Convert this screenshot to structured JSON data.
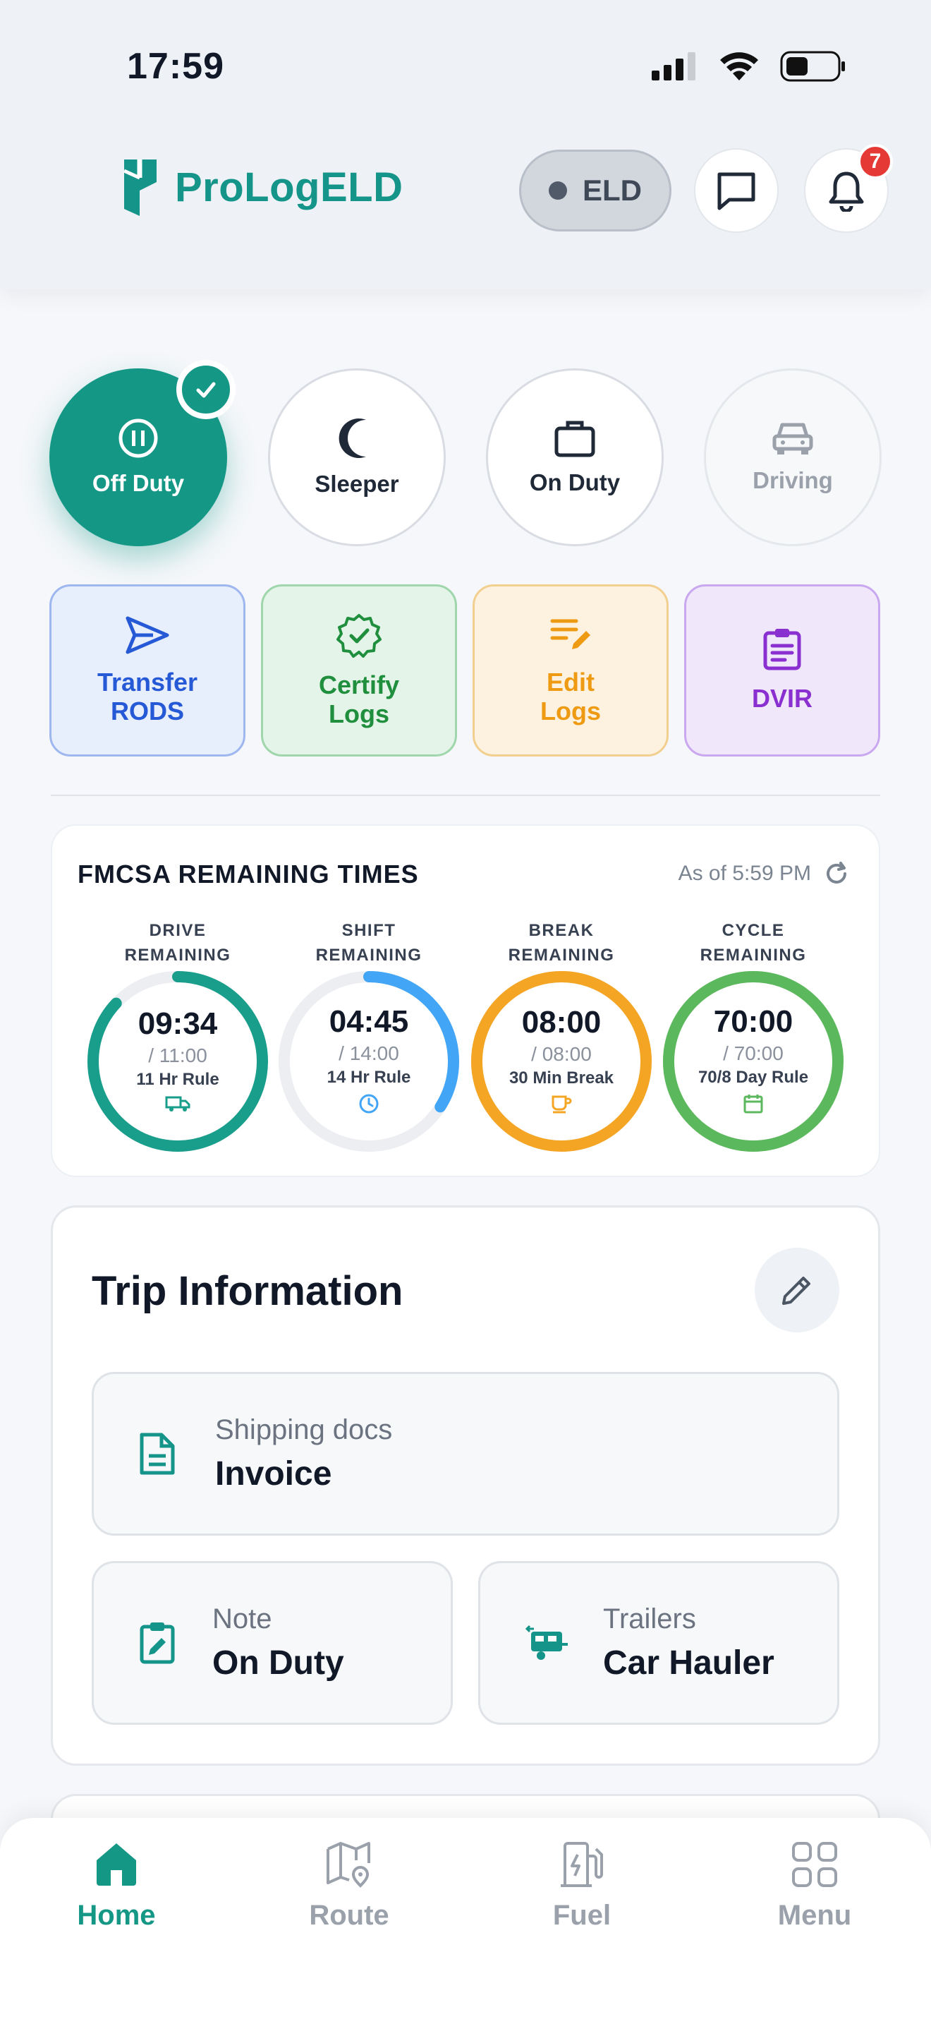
{
  "status_bar": {
    "time": "17:59"
  },
  "header": {
    "logo_text": "ProLogELD",
    "eld_label": "ELD",
    "notification_count": "7"
  },
  "duty_status": {
    "items": [
      {
        "label": "Off Duty",
        "icon": "pause-circle-icon",
        "state": "active"
      },
      {
        "label": "Sleeper",
        "icon": "moon-icon",
        "state": "normal"
      },
      {
        "label": "On Duty",
        "icon": "briefcase-icon",
        "state": "normal"
      },
      {
        "label": "Driving",
        "icon": "car-icon",
        "state": "disabled"
      }
    ]
  },
  "actions": {
    "transfer_line1": "Transfer",
    "transfer_line2": "RODS",
    "certify_line1": "Certify",
    "certify_line2": "Logs",
    "edit_line1": "Edit",
    "edit_line2": "Logs",
    "dvir": "DVIR"
  },
  "fmcsa": {
    "title": "FMCSA REMAINING TIMES",
    "as_of": "As of 5:59 PM",
    "gauges": [
      {
        "label1": "DRIVE",
        "label2": "REMAINING",
        "value": "09:34",
        "total": "/ 11:00",
        "rule": "11 Hr Rule",
        "icon": "truck-icon",
        "fraction": 0.87,
        "color": "#1a9e8c"
      },
      {
        "label1": "SHIFT",
        "label2": "REMAINING",
        "value": "04:45",
        "total": "/ 14:00",
        "rule": "14 Hr Rule",
        "icon": "clock-icon",
        "fraction": 0.34,
        "color": "#42a5f5"
      },
      {
        "label1": "BREAK",
        "label2": "REMAINING",
        "value": "08:00",
        "total": "/ 08:00",
        "rule": "30 Min Break",
        "icon": "coffee-icon",
        "fraction": 1.0,
        "color": "#f5a524"
      },
      {
        "label1": "CYCLE",
        "label2": "REMAINING",
        "value": "70:00",
        "total": "/ 70:00",
        "rule": "70/8 Day Rule",
        "icon": "calendar-icon",
        "fraction": 1.0,
        "color": "#5cb85c"
      }
    ]
  },
  "trip": {
    "title": "Trip Information",
    "shipping_label": "Shipping docs",
    "shipping_value": "Invoice",
    "note_label": "Note",
    "note_value": "On Duty",
    "trailers_label": "Trailers",
    "trailers_value": "Car Hauler"
  },
  "bottom_nav": {
    "home": "Home",
    "route": "Route",
    "fuel": "Fuel",
    "menu": "Menu",
    "active": "home"
  },
  "colors": {
    "brand": "#159786",
    "inactive": "#9aa1ab"
  }
}
